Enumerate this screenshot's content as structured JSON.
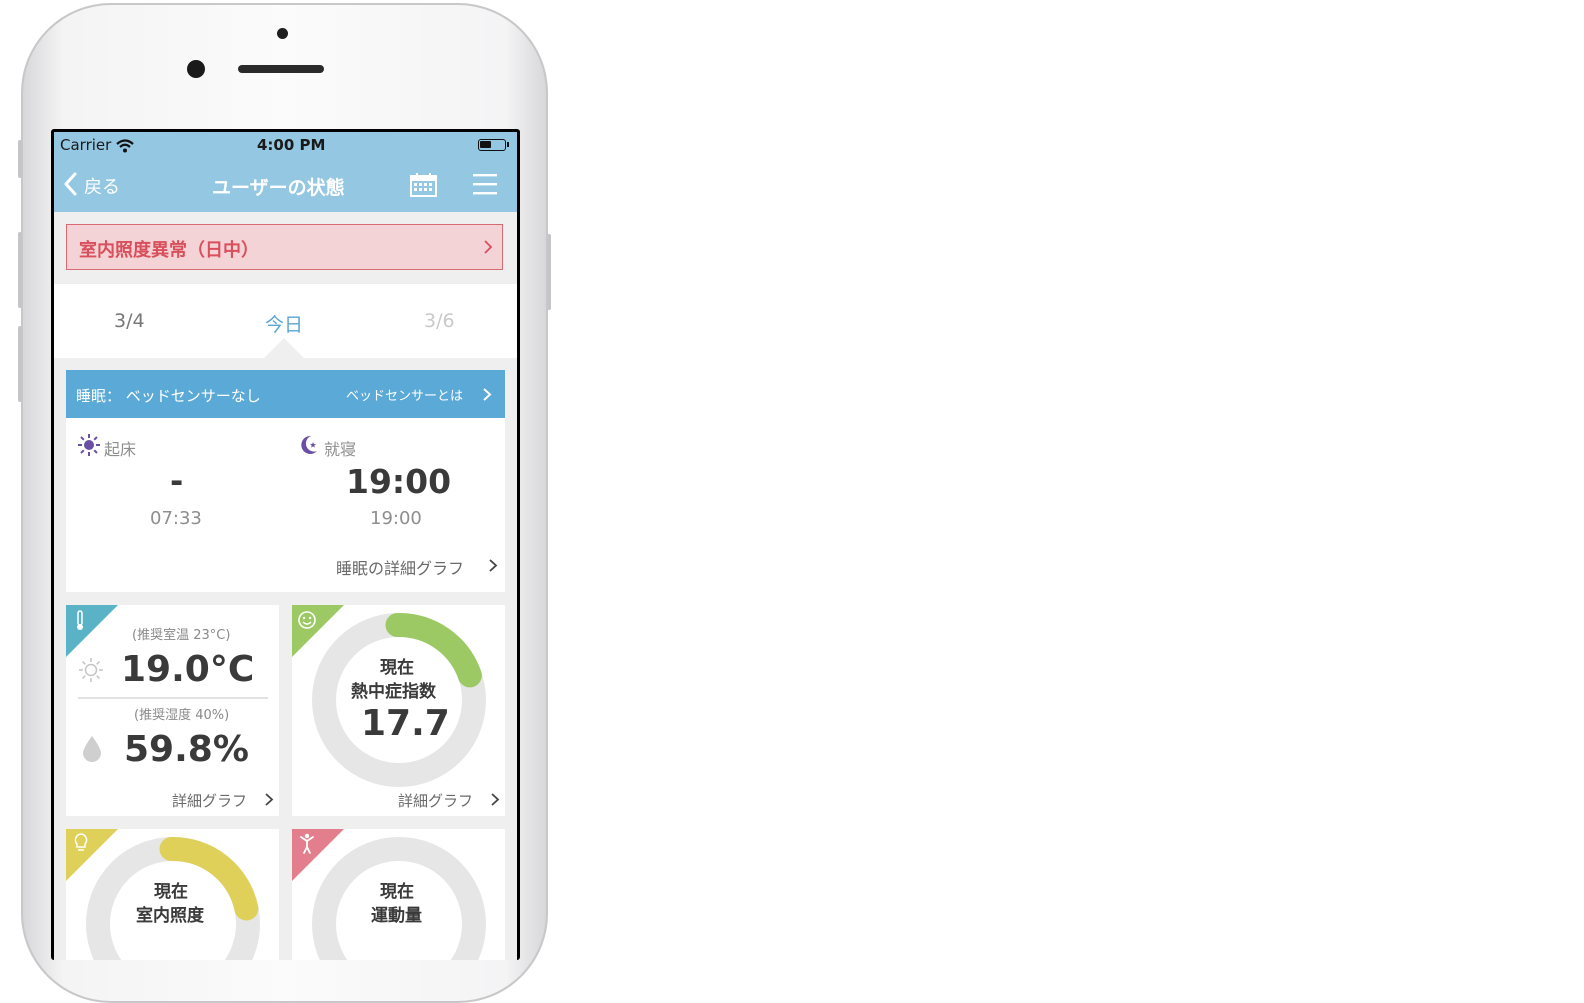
{
  "status_bar": {
    "carrier": "Carrier",
    "time": "4:00 PM"
  },
  "nav": {
    "back_label": "戻る",
    "title": "ユーザーの状態",
    "calendar_icon": "calendar-icon",
    "menu_icon": "hamburger-menu-icon"
  },
  "alert": {
    "text": "室内照度異常（日中）",
    "color": "#d94f5c"
  },
  "dates": {
    "prev": "3/4",
    "current": "今日",
    "next": "3/6"
  },
  "sleep": {
    "header_label": "睡眠： ベッドセンサーなし",
    "header_link": "ベッドセンサーとは",
    "wake": {
      "label": "起床",
      "value": "-",
      "sub": "07:33"
    },
    "bed": {
      "label": "就寝",
      "value": "19:00",
      "sub": "19:00"
    },
    "detail_link": "睡眠の詳細グラフ"
  },
  "room": {
    "temp_note": "(推奨室温 23°C)",
    "temp_value": "19.0°C",
    "hum_note": "(推奨湿度 40%)",
    "hum_value": "59.8%",
    "detail_link": "詳細グラフ",
    "accent": "#5ab2c6"
  },
  "heat": {
    "line1": "現在",
    "line2": "熱中症指数",
    "value": "17.7",
    "gauge_fraction": 0.2,
    "detail_link": "詳細グラフ",
    "accent": "#9cc964"
  },
  "light": {
    "line1": "現在",
    "line2": "室内照度",
    "gauge_fraction": 0.22,
    "accent": "#dfd05a"
  },
  "activity": {
    "line1": "現在",
    "line2": "運動量",
    "gauge_fraction": 0.0,
    "accent": "#e37f8c"
  }
}
